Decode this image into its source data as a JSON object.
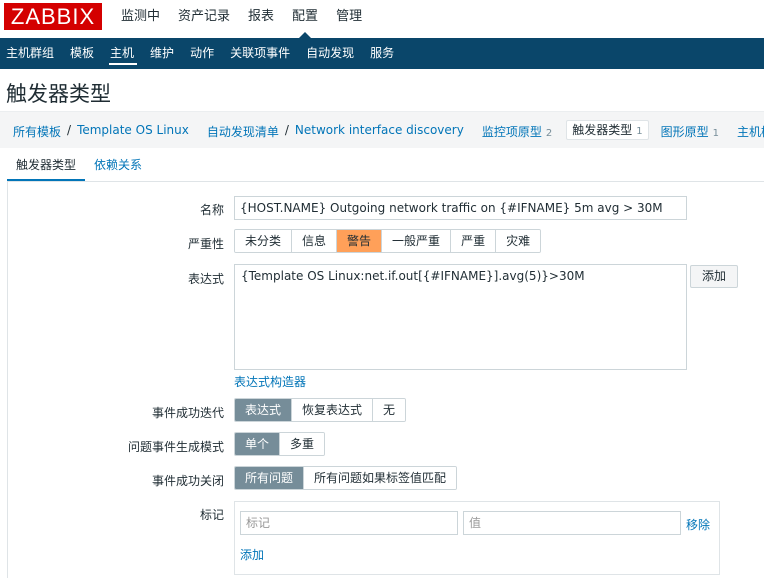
{
  "logo": "ZABBIX",
  "top_menu": [
    "监测中",
    "资产记录",
    "报表",
    "配置",
    "管理"
  ],
  "sub_menu": [
    "主机群组",
    "模板",
    "主机",
    "维护",
    "动作",
    "关联项事件",
    "自动发现",
    "服务"
  ],
  "page_title": "触发器类型",
  "breadcrumb": {
    "all_templates": "所有模板",
    "sep": "/",
    "template": "Template OS Linux",
    "discovery_list": "自动发现清单",
    "discovery": "Network interface discovery",
    "item_prototypes": "监控项原型",
    "item_prototypes_count": "2",
    "trigger_prototypes": "触发器类型",
    "trigger_prototypes_count": "1",
    "graph_prototypes": "图形原型",
    "graph_prototypes_count": "1",
    "host_templates": "主机模板"
  },
  "tabs": [
    "触发器类型",
    "依赖关系"
  ],
  "form": {
    "name_label": "名称",
    "name_value": "{HOST.NAME} Outgoing network traffic on {#IFNAME} 5m avg > 30M",
    "severity_label": "严重性",
    "severity_options": [
      "未分类",
      "信息",
      "警告",
      "一般严重",
      "严重",
      "灾难"
    ],
    "severity_selected": "警告",
    "expression_label": "表达式",
    "expression_value": "{Template OS Linux:net.if.out[{#IFNAME}].avg(5)}>30M",
    "add_button": "添加",
    "expression_builder": "表达式构造器",
    "ok_event_gen_label": "事件成功迭代",
    "ok_event_gen_options": [
      "表达式",
      "恢复表达式",
      "无"
    ],
    "problem_mode_label": "问题事件生成模式",
    "problem_mode_options": [
      "单个",
      "多重"
    ],
    "ok_close_label": "事件成功关闭",
    "ok_close_options": [
      "所有问题",
      "所有问题如果标签值匹配"
    ],
    "tags_label": "标记",
    "tag_placeholder": "标记",
    "value_placeholder": "值",
    "remove_link": "移除",
    "add_link": "添加"
  }
}
